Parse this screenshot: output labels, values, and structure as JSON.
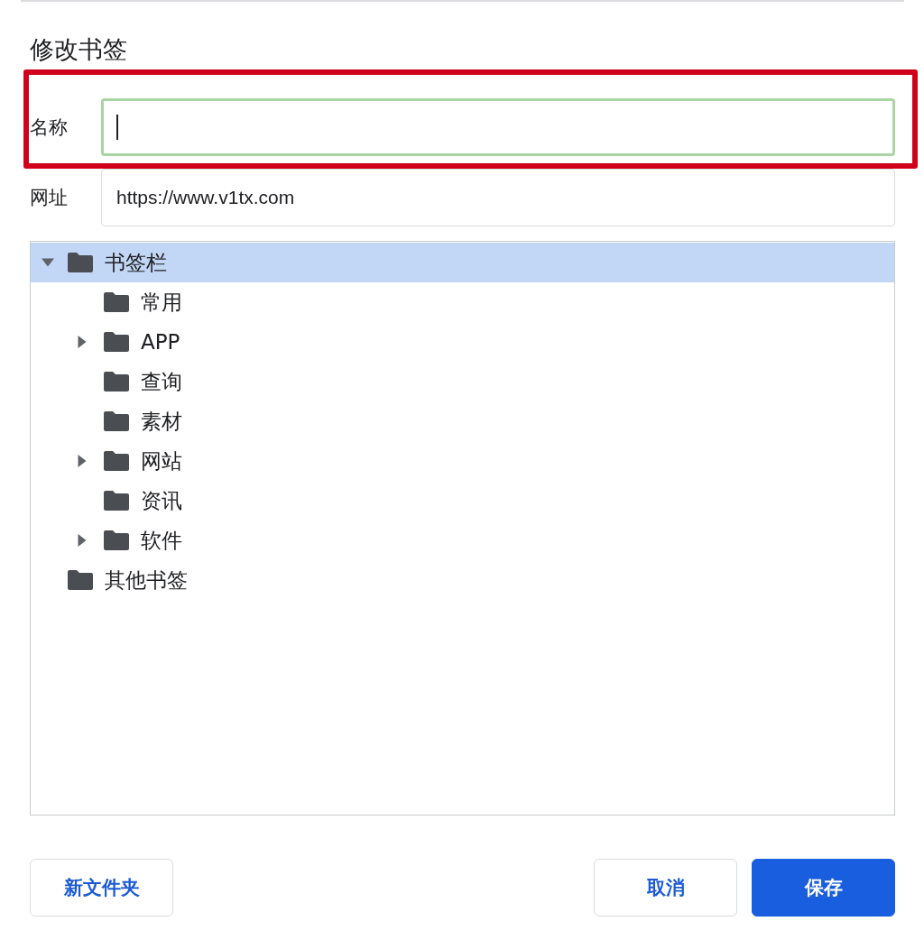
{
  "dialog": {
    "title": "修改书签"
  },
  "fields": [
    {
      "label": "名称",
      "focused": true,
      "highlighted": true
    },
    {
      "label": "网址",
      "value": "https://www.v1tx.com",
      "focused": false,
      "highlighted": false
    }
  ],
  "tree": [
    {
      "label": "书签栏",
      "selected": true,
      "kind": "expanded",
      "children": [
        {
          "label": "常用",
          "selected": false,
          "kind": "leaf"
        },
        {
          "label": "APP",
          "selected": false,
          "kind": "collapsed"
        },
        {
          "label": "查询",
          "selected": false,
          "kind": "leaf"
        },
        {
          "label": "素材",
          "selected": false,
          "kind": "leaf"
        },
        {
          "label": "网站",
          "selected": false,
          "kind": "collapsed"
        },
        {
          "label": "资讯",
          "selected": false,
          "kind": "leaf"
        },
        {
          "label": "软件",
          "selected": false,
          "kind": "collapsed"
        }
      ]
    },
    {
      "label": "其他书签",
      "selected": false,
      "kind": "leaf"
    }
  ],
  "buttons_left": [
    {
      "label": "新文件夹",
      "kind": "secondary"
    }
  ],
  "buttons_right": [
    {
      "label": "取消",
      "kind": "secondary"
    },
    {
      "label": "保存",
      "kind": "primary"
    }
  ]
}
